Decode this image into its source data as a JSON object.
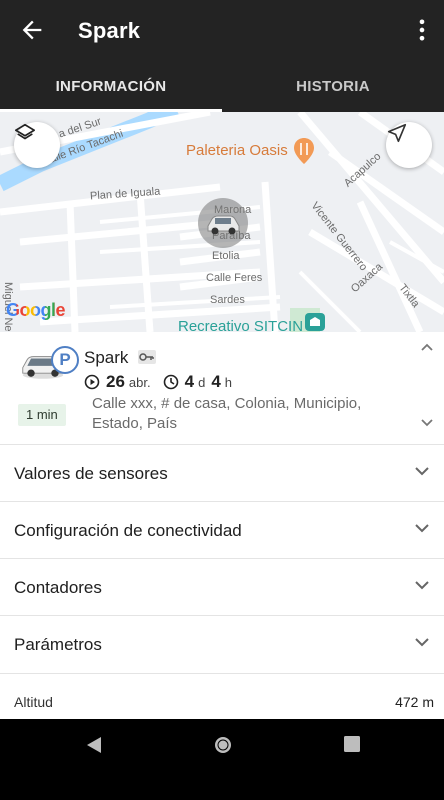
{
  "app_bar": {
    "title": "Spark",
    "tabs": [
      {
        "label": "INFORMACIÓN",
        "active": true
      },
      {
        "label": "HISTORIA",
        "active": false
      }
    ]
  },
  "map": {
    "labels": {
      "street_1": "Calle Río Tacachi",
      "street_2": "a del Sur",
      "street_3": "Plan de Iguala",
      "street_4": "Marona",
      "street_5": "Etolia",
      "street_6": "Calle Feres",
      "street_7": "Sardes",
      "street_8": "Miguel Negrete",
      "street_9": "Vicente Guerrero",
      "street_10": "Acapulco",
      "street_11": "Oaxaca",
      "street_12": "Tixtla",
      "street_13": "Paraíba",
      "poi_1": "Paleteria Oasis",
      "poi_2": "Recreativo SITCIN",
      "watermark": "Google"
    },
    "layers_icon": "layers-icon",
    "locate_icon": "navigation-arrow-icon"
  },
  "vehicle": {
    "name": "Spark",
    "date_day": "26",
    "date_month": "abr.",
    "duration_days_value": "4",
    "duration_days_unit": "d",
    "duration_hours_value": "4",
    "duration_hours_unit": "h",
    "address": "Calle xxx, # de casa, Colonia, Municipio, Estado, País",
    "time_chip": "1 min",
    "status_badge": "P"
  },
  "sections": [
    {
      "label": "Valores de sensores"
    },
    {
      "label": "Configuración de conectividad"
    },
    {
      "label": "Contadores"
    },
    {
      "label": "Parámetros"
    }
  ],
  "altitude": {
    "label": "Altitud",
    "value": "472 m"
  },
  "colors": {
    "app_bar": "#232323",
    "accent_blue": "#4f7fc4",
    "chip_bg": "#e7f3e9"
  }
}
